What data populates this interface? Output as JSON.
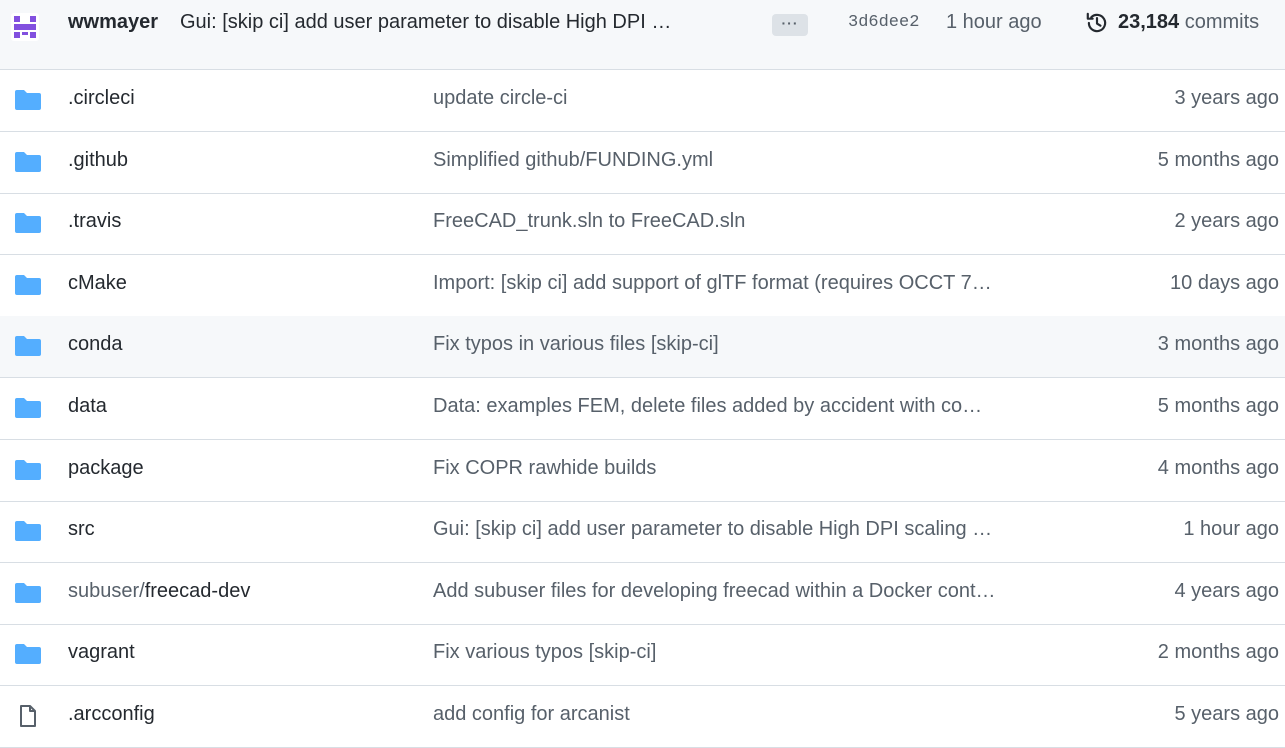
{
  "latest_commit": {
    "author": "wwmayer",
    "message": "Gui: [skip ci] add user parameter to disable High DPI …",
    "more_label": "···",
    "sha": "3d6dee2",
    "time": "1 hour ago",
    "commit_count": "23,184",
    "commits_label": "commits",
    "avatar_color": "#8250df"
  },
  "files": [
    {
      "type": "folder",
      "name": ".circleci",
      "message": "update circle-ci",
      "time": "3 years ago"
    },
    {
      "type": "folder",
      "name": ".github",
      "message": "Simplified github/FUNDING.yml",
      "time": "5 months ago"
    },
    {
      "type": "folder",
      "name": ".travis",
      "message": "FreeCAD_trunk.sln to FreeCAD.sln",
      "time": "2 years ago"
    },
    {
      "type": "folder",
      "name": "cMake",
      "message": "Import: [skip ci] add support of glTF format (requires OCCT 7…",
      "time": "10 days ago"
    },
    {
      "type": "folder",
      "name": "conda",
      "message": "Fix typos in various files [skip-ci]",
      "time": "3 months ago"
    },
    {
      "type": "folder",
      "name": "data",
      "message": "Data: examples FEM, delete files added by accident with co…",
      "time": "5 months ago"
    },
    {
      "type": "folder",
      "name": "package",
      "message": "Fix COPR rawhide builds",
      "time": "4 months ago"
    },
    {
      "type": "folder",
      "name": "src",
      "message": "Gui: [skip ci] add user parameter to disable High DPI scaling …",
      "time": "1 hour ago"
    },
    {
      "type": "folder",
      "dir_prefix": "subuser/",
      "name": "freecad-dev",
      "message": "Add subuser files for developing freecad within a Docker cont…",
      "time": "4 years ago"
    },
    {
      "type": "folder",
      "name": "vagrant",
      "message": "Fix various typos [skip-ci]",
      "time": "2 months ago"
    },
    {
      "type": "file",
      "name": ".arcconfig",
      "message": "add config for arcanist",
      "time": "5 years ago"
    }
  ],
  "colors": {
    "folder": "#54aeff",
    "file_icon": "#57606a",
    "header_bg": "#f6f8fa",
    "border": "#d8dee4"
  },
  "icons": {
    "folder": "folder-icon",
    "file": "file-icon",
    "history": "history-icon"
  }
}
